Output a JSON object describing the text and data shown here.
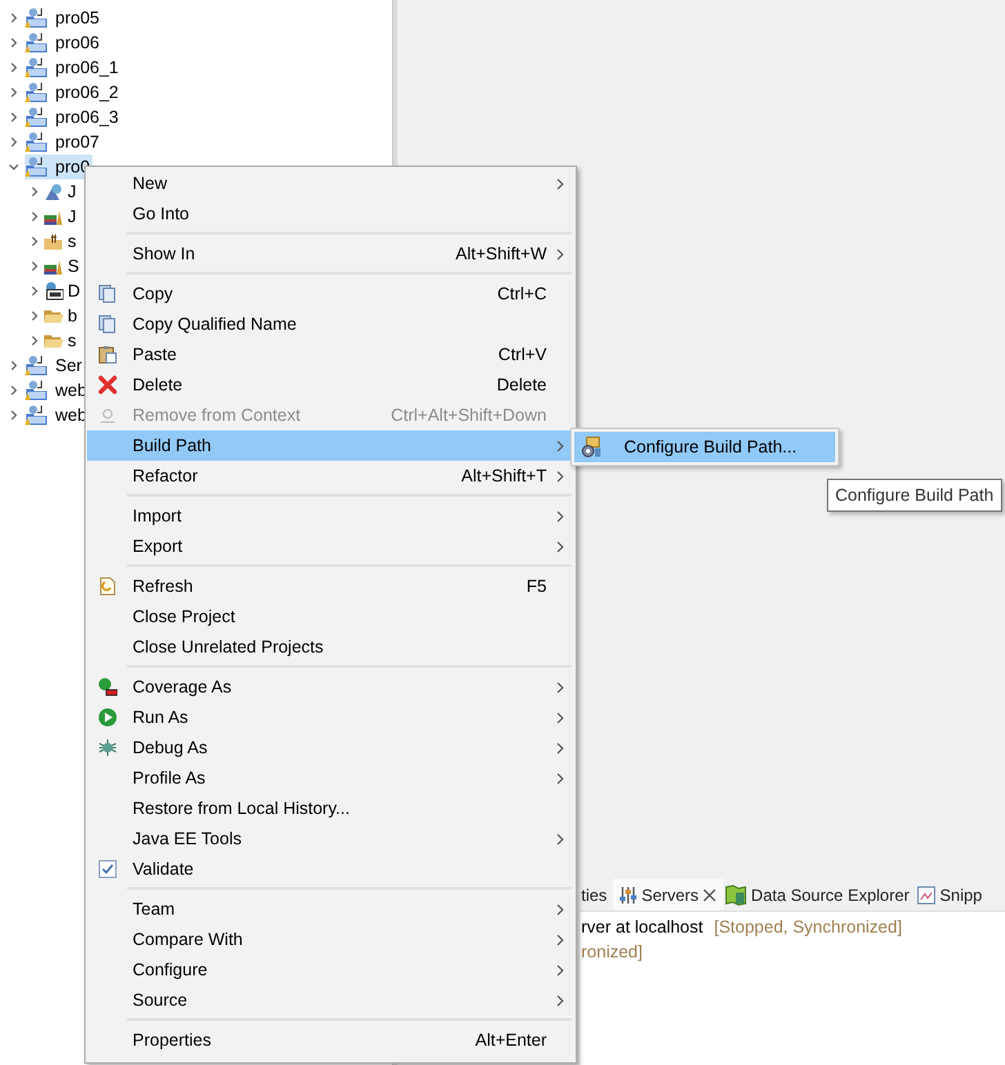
{
  "tree": {
    "items": [
      {
        "label": "pro05",
        "expanded": false,
        "selected": false
      },
      {
        "label": "pro06",
        "expanded": false,
        "selected": false
      },
      {
        "label": "pro06_1",
        "expanded": false,
        "selected": false
      },
      {
        "label": "pro06_2",
        "expanded": false,
        "selected": false
      },
      {
        "label": "pro06_3",
        "expanded": false,
        "selected": false
      },
      {
        "label": "pro07",
        "expanded": false,
        "selected": false
      },
      {
        "label": "pro0",
        "expanded": true,
        "selected": true,
        "children": [
          {
            "label": "J",
            "expanded": false,
            "selected": false
          },
          {
            "label": "J",
            "expanded": false,
            "selected": false
          },
          {
            "label": "s",
            "expanded": false,
            "selected": false
          },
          {
            "label": "S",
            "expanded": false,
            "selected": false
          },
          {
            "label": "D",
            "expanded": false,
            "selected": false
          },
          {
            "label": "b",
            "expanded": false,
            "selected": false
          },
          {
            "label": "s",
            "expanded": false,
            "selected": false
          }
        ]
      },
      {
        "label": "Ser",
        "expanded": false,
        "selected": false
      },
      {
        "label": "web",
        "expanded": false,
        "selected": false
      },
      {
        "label": "web",
        "expanded": false,
        "selected": false
      }
    ]
  },
  "context_menu": {
    "groups": [
      [
        {
          "label": "New",
          "submenu": true,
          "disabled": false,
          "selected": false
        },
        {
          "label": "Go Into",
          "submenu": false,
          "disabled": false,
          "selected": false
        }
      ],
      [
        {
          "label": "Show In",
          "shortcut": "Alt+Shift+W",
          "submenu": true,
          "disabled": false,
          "selected": false
        }
      ],
      [
        {
          "label": "Copy",
          "shortcut": "Ctrl+C",
          "submenu": false,
          "disabled": false,
          "selected": false
        },
        {
          "label": "Copy Qualified Name",
          "submenu": false,
          "disabled": false,
          "selected": false
        },
        {
          "label": "Paste",
          "shortcut": "Ctrl+V",
          "submenu": false,
          "disabled": false,
          "selected": false
        },
        {
          "label": "Delete",
          "shortcut": "Delete",
          "submenu": false,
          "disabled": false,
          "selected": false
        },
        {
          "label": "Remove from Context",
          "shortcut": "Ctrl+Alt+Shift+Down",
          "submenu": false,
          "disabled": true,
          "selected": false
        },
        {
          "label": "Build Path",
          "submenu": true,
          "disabled": false,
          "selected": true
        },
        {
          "label": "Refactor",
          "shortcut": "Alt+Shift+T",
          "submenu": true,
          "disabled": false,
          "selected": false
        }
      ],
      [
        {
          "label": "Import",
          "submenu": true,
          "disabled": false,
          "selected": false
        },
        {
          "label": "Export",
          "submenu": true,
          "disabled": false,
          "selected": false
        }
      ],
      [
        {
          "label": "Refresh",
          "shortcut": "F5",
          "submenu": false,
          "disabled": false,
          "selected": false
        },
        {
          "label": "Close Project",
          "submenu": false,
          "disabled": false,
          "selected": false
        },
        {
          "label": "Close Unrelated Projects",
          "submenu": false,
          "disabled": false,
          "selected": false
        }
      ],
      [
        {
          "label": "Coverage As",
          "submenu": true,
          "disabled": false,
          "selected": false
        },
        {
          "label": "Run As",
          "submenu": true,
          "disabled": false,
          "selected": false
        },
        {
          "label": "Debug As",
          "submenu": true,
          "disabled": false,
          "selected": false
        },
        {
          "label": "Profile As",
          "submenu": true,
          "disabled": false,
          "selected": false
        },
        {
          "label": "Restore from Local History...",
          "submenu": false,
          "disabled": false,
          "selected": false
        },
        {
          "label": "Java EE Tools",
          "submenu": true,
          "disabled": false,
          "selected": false
        },
        {
          "label": "Validate",
          "submenu": false,
          "disabled": false,
          "selected": false
        }
      ],
      [
        {
          "label": "Team",
          "submenu": true,
          "disabled": false,
          "selected": false
        },
        {
          "label": "Compare With",
          "submenu": true,
          "disabled": false,
          "selected": false
        },
        {
          "label": "Configure",
          "submenu": true,
          "disabled": false,
          "selected": false
        },
        {
          "label": "Source",
          "submenu": true,
          "disabled": false,
          "selected": false
        }
      ],
      [
        {
          "label": "Properties",
          "shortcut": "Alt+Enter",
          "submenu": false,
          "disabled": false,
          "selected": false
        }
      ]
    ]
  },
  "submenu": {
    "items": [
      {
        "label": "Configure Build Path...",
        "selected": true
      }
    ]
  },
  "tooltip": {
    "text": "Configure Build Path"
  },
  "bottom_panel": {
    "tabs": [
      {
        "label": "ties",
        "selected": false,
        "closable": false
      },
      {
        "label": "Servers",
        "selected": true,
        "closable": true
      },
      {
        "label": "Data Source Explorer",
        "selected": false,
        "closable": false
      },
      {
        "label": "Snipp",
        "selected": false,
        "closable": false
      }
    ],
    "rows": [
      {
        "name": "rver at localhost",
        "status": "[Stopped, Synchronized]"
      },
      {
        "status": "ronized]"
      }
    ]
  }
}
